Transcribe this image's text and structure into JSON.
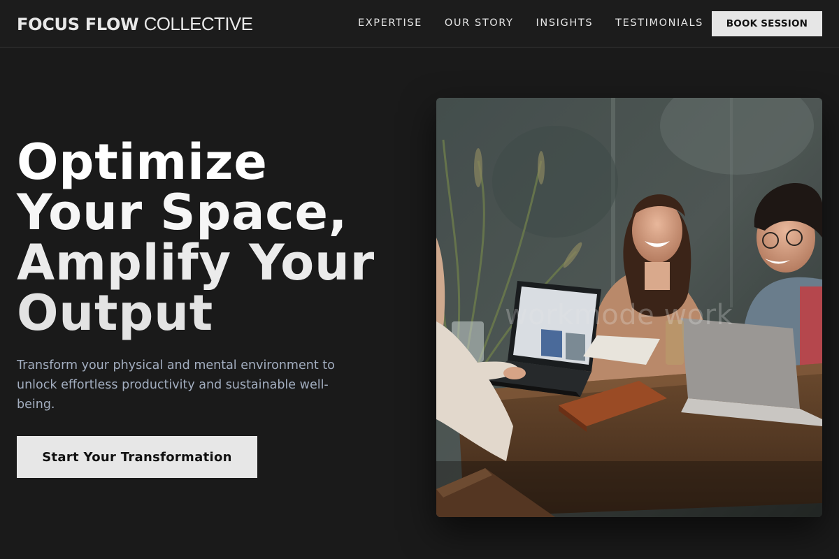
{
  "nav": {
    "brand_bold": "FOCUS FLOW",
    "brand_light": "COLLECTIVE",
    "links": [
      "EXPERTISE",
      "OUR STORY",
      "INSIGHTS",
      "TESTIMONIALS"
    ],
    "cta": "BOOK SESSION"
  },
  "hero": {
    "headline": [
      "Optimize",
      "Your Space,",
      "Amplify Your",
      "Output"
    ],
    "subtext": "Transform your physical and mental environment to unlock effortless productivity and sustainable well-being.",
    "cta": "Start Your Transformation"
  },
  "image": {
    "watermark": "workmode work"
  },
  "colors": {
    "background": "#1a1a1a",
    "subtext": "#a3aec0",
    "button_bg": "#e6e6e6"
  }
}
